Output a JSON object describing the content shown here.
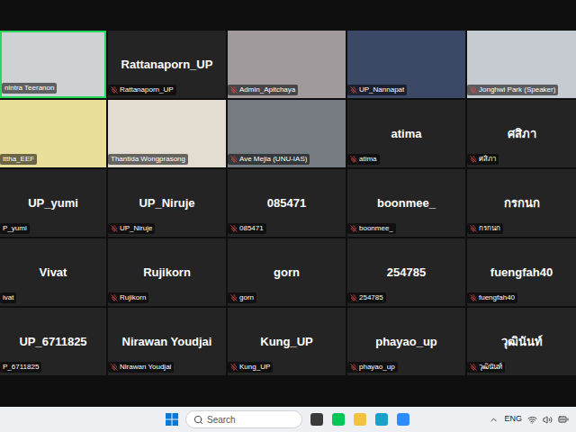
{
  "meeting": {
    "tiles": [
      {
        "kind": "video",
        "label": "nintra Teeranon",
        "muted": false,
        "speaking": true,
        "color": "#cfd2d4"
      },
      {
        "kind": "name",
        "name": "Rattanaporn_UP",
        "label": "Rattanaporn_UP",
        "muted": true,
        "speaking": false
      },
      {
        "kind": "video",
        "label": "Admin_Apitchaya",
        "muted": true,
        "speaking": false,
        "color": "#a09a9c"
      },
      {
        "kind": "video",
        "label": "UP_Nannapat",
        "muted": true,
        "speaking": false,
        "color": "#3b4866"
      },
      {
        "kind": "video",
        "label": "Jonghwi Park (Speaker)",
        "muted": true,
        "speaking": false,
        "color": "#c6cbd2"
      },
      {
        "kind": "video",
        "label": "ittha_EEF",
        "muted": false,
        "speaking": false,
        "color": "#e9df9a"
      },
      {
        "kind": "video",
        "label": "Thantida Wongprasong",
        "muted": false,
        "speaking": false,
        "color": "#e2ddd0"
      },
      {
        "kind": "video",
        "label": "Ave Mejia (UNU-IAS)",
        "muted": true,
        "speaking": false,
        "color": "#767b82"
      },
      {
        "kind": "name",
        "name": "atima",
        "label": "atima",
        "muted": true,
        "speaking": false
      },
      {
        "kind": "name",
        "name": "ศสิภา",
        "label": "ศสิภา",
        "muted": true,
        "speaking": false
      },
      {
        "kind": "name",
        "name": "UP_yumi",
        "label": "P_yumi",
        "muted": false,
        "speaking": false
      },
      {
        "kind": "name",
        "name": "UP_Niruje",
        "label": "UP_Niruje",
        "muted": true,
        "speaking": false
      },
      {
        "kind": "name",
        "name": "085471",
        "label": "085471",
        "muted": true,
        "speaking": false
      },
      {
        "kind": "name",
        "name": "boonmee_",
        "label": "boonmee_",
        "muted": true,
        "speaking": false
      },
      {
        "kind": "name",
        "name": "กรกนก",
        "label": "กรกนก",
        "muted": true,
        "speaking": false
      },
      {
        "kind": "name",
        "name": "Vivat",
        "label": "ivat",
        "muted": false,
        "speaking": false
      },
      {
        "kind": "name",
        "name": "Rujikorn",
        "label": "Rujikorn",
        "muted": true,
        "speaking": false
      },
      {
        "kind": "name",
        "name": "gorn",
        "label": "gorn",
        "muted": true,
        "speaking": false
      },
      {
        "kind": "name",
        "name": "254785",
        "label": "254785",
        "muted": true,
        "speaking": false
      },
      {
        "kind": "name",
        "name": "fuengfah40",
        "label": "fuengfah40",
        "muted": true,
        "speaking": false
      },
      {
        "kind": "name",
        "name": "UP_6711825",
        "label": "P_6711825",
        "muted": false,
        "speaking": false
      },
      {
        "kind": "name",
        "name": "Nirawan Youdjai",
        "label": "Nirawan Youdjai",
        "muted": true,
        "speaking": false
      },
      {
        "kind": "name",
        "name": "Kung_UP",
        "label": "Kung_UP",
        "muted": true,
        "speaking": false
      },
      {
        "kind": "name",
        "name": "phayao_up",
        "label": "phayao_up",
        "muted": true,
        "speaking": false
      },
      {
        "kind": "name",
        "name": "วุฒินันท์",
        "label": "วุฒินันท์",
        "muted": true,
        "speaking": false
      }
    ]
  },
  "taskbar": {
    "search": {
      "placeholder": "Search"
    },
    "language": "ENG"
  }
}
